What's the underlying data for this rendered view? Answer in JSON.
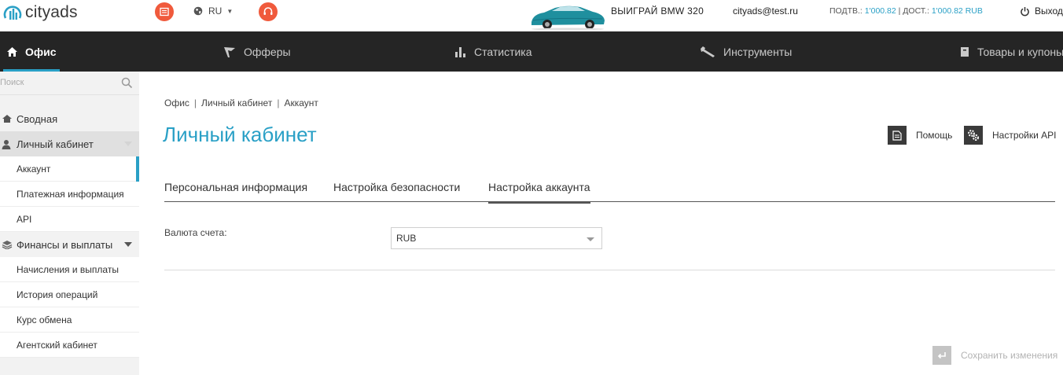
{
  "header": {
    "logo_text": "cityads",
    "language": "RU",
    "promo": "ВЫИГРАЙ BMW 320",
    "email": "cityads@test.ru",
    "balance_confirmed_label": "ПОДТВ.: ",
    "balance_confirmed_value": "1'000.82",
    "balance_separator": " | ",
    "balance_available_label": "ДОСТ.: ",
    "balance_available_value": "1'000.82 RUB",
    "logout_label": "Выход",
    "accent_color": "#f05a3c"
  },
  "nav": {
    "items": [
      {
        "label": "Офис",
        "icon": "home-icon",
        "active": true
      },
      {
        "label": "Офферы",
        "icon": "flag-icon"
      },
      {
        "label": "Статистика",
        "icon": "bar-chart-icon"
      },
      {
        "label": "Инструменты",
        "icon": "wrench-icon"
      },
      {
        "label": "Товары и купоны",
        "icon": "box-icon"
      }
    ],
    "accent_color": "#2aa0c6"
  },
  "sidebar": {
    "search_placeholder": "Поиск",
    "sections": [
      {
        "label": "Сводная",
        "icon": "house-icon"
      },
      {
        "label": "Личный кабинет",
        "icon": "user-icon",
        "expanded": true,
        "children": [
          {
            "label": "Аккаунт",
            "active": true
          },
          {
            "label": "Платежная информация"
          },
          {
            "label": "API"
          }
        ]
      },
      {
        "label": "Финансы и выплаты",
        "icon": "money-stack-icon",
        "expanded": true,
        "children": [
          {
            "label": "Начисления и выплаты"
          },
          {
            "label": "История операций"
          },
          {
            "label": "Курс обмена"
          },
          {
            "label": "Агентский кабинет"
          }
        ]
      }
    ]
  },
  "breadcrumb": [
    "Офис",
    "Личный кабинет",
    "Аккаунт"
  ],
  "page": {
    "title": "Личный кабинет",
    "help_label": "Помощь",
    "api_settings_label": "Настройки API",
    "tabs": [
      {
        "label": "Персональная информация"
      },
      {
        "label": "Настройка безопасности"
      },
      {
        "label": "Настройка аккаунта",
        "active": true
      }
    ],
    "currency_label": "Валюта счета:",
    "currency_value": "RUB",
    "save_label": "Сохранить изменения"
  }
}
